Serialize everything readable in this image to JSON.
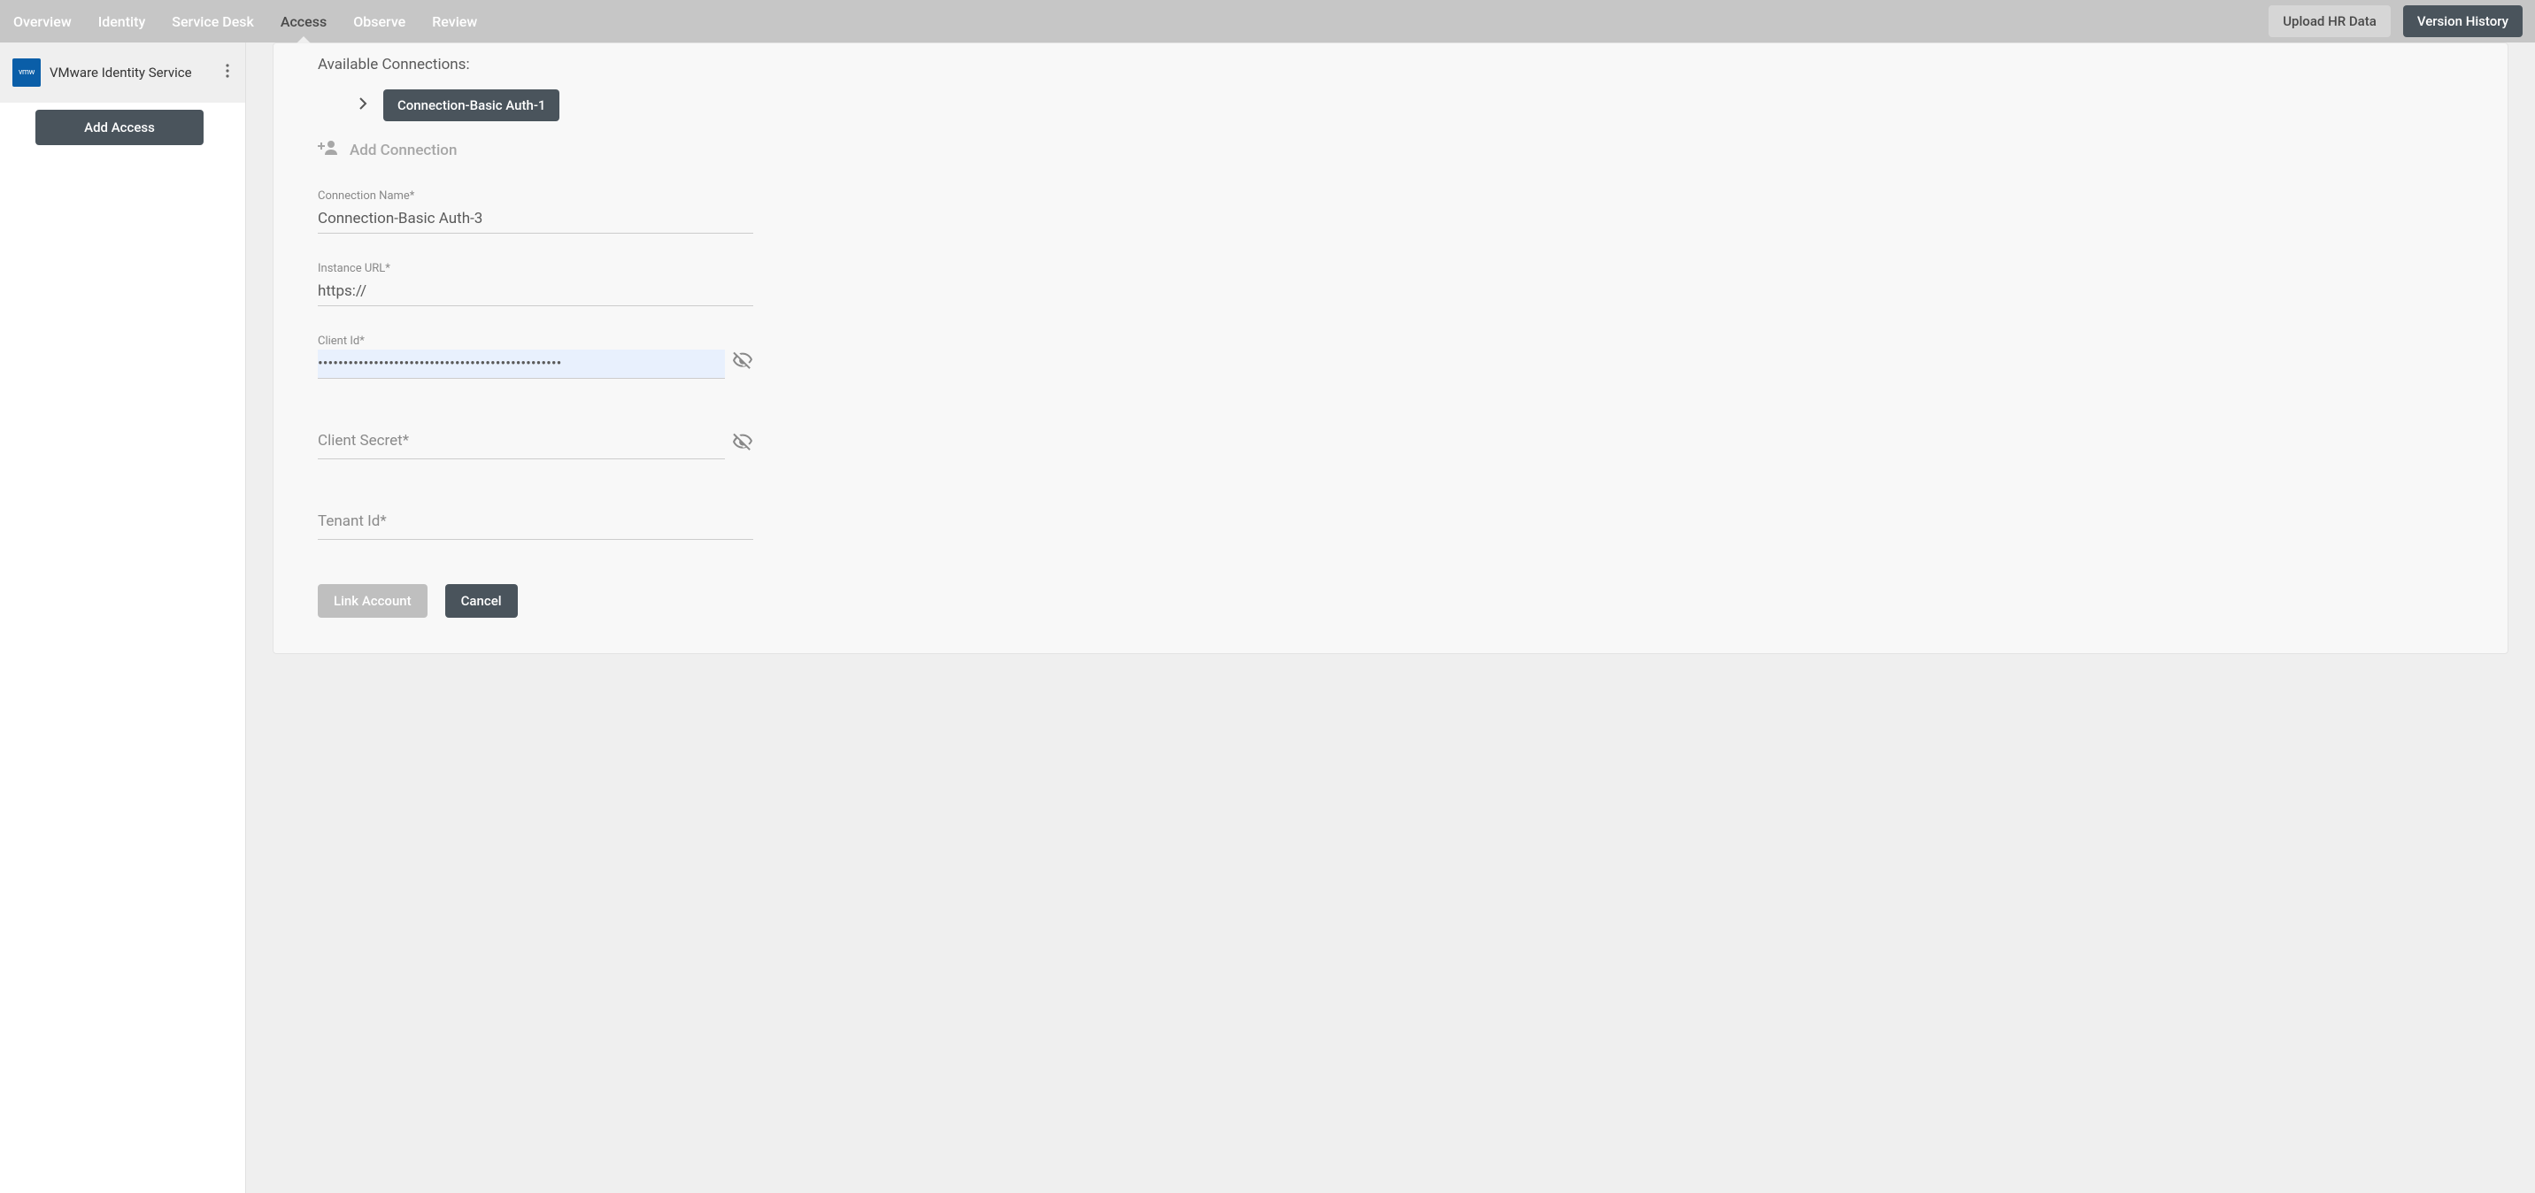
{
  "nav": {
    "items": [
      "Overview",
      "Identity",
      "Service Desk",
      "Access",
      "Observe",
      "Review"
    ],
    "active_index": 3,
    "upload_hr": "Upload HR Data",
    "version_history": "Version History"
  },
  "sidebar": {
    "service_name": "VMware Identity Service",
    "logo_text": "vmw",
    "add_access": "Add Access"
  },
  "content": {
    "available_label": "Available Connections:",
    "connections": [
      "Connection-Basic Auth-1"
    ],
    "add_connection": "Add Connection",
    "form": {
      "conn_name_label": "Connection Name*",
      "conn_name_value": "Connection-Basic Auth-3",
      "instance_url_label": "Instance URL*",
      "instance_url_value": "https://",
      "client_id_label": "Client Id*",
      "client_id_value": "••••••••••••••••••••••••••••••••••••••••••••••••",
      "client_secret_label": "Client Secret*",
      "client_secret_value": "",
      "tenant_id_label": "Tenant Id*",
      "tenant_id_value": "",
      "link_account": "Link Account",
      "cancel": "Cancel"
    }
  }
}
